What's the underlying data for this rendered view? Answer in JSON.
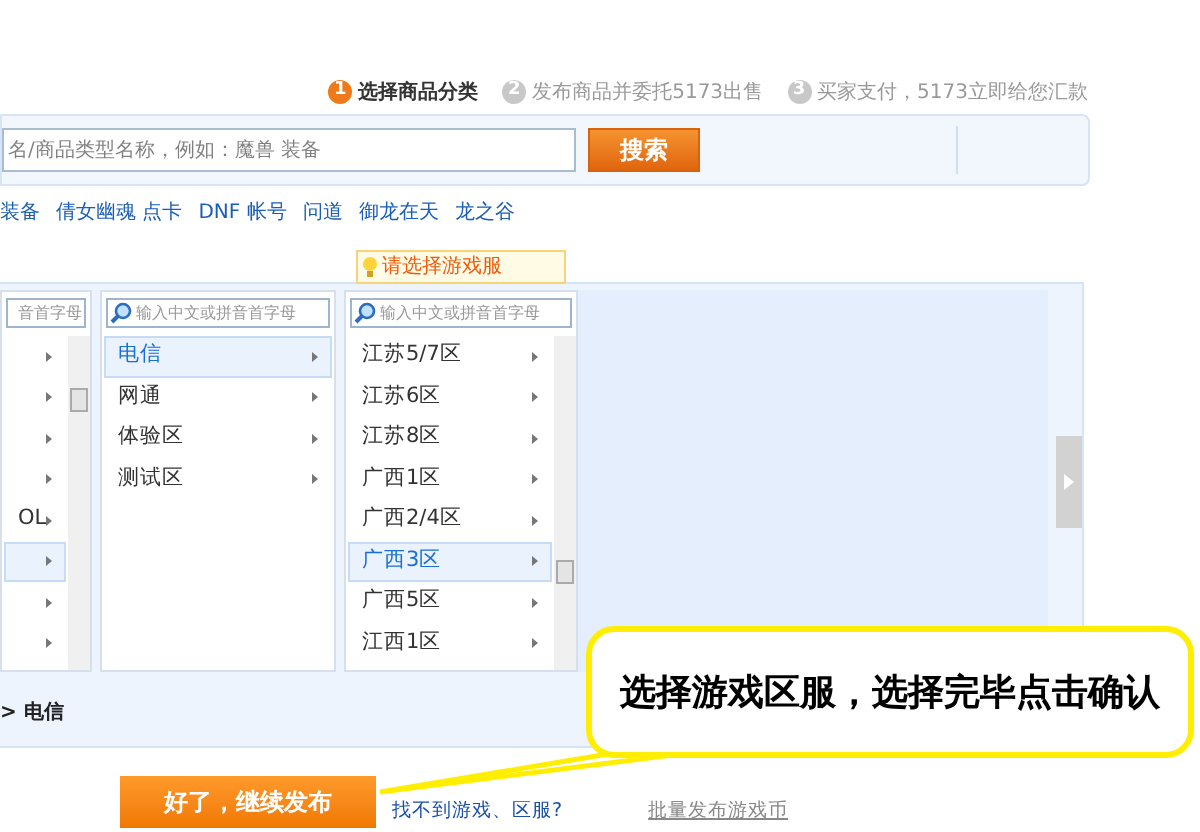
{
  "steps": [
    {
      "number": "1",
      "label": "选择商品分类",
      "selected": true
    },
    {
      "number": "2",
      "label": "发布商品并委托5173出售",
      "selected": false
    },
    {
      "number": "3",
      "label": "买家支付，5173立即给您汇款",
      "selected": false
    }
  ],
  "search": {
    "placeholder": "名/商品类型名称，例如：魔兽 装备",
    "button": "搜索"
  },
  "hot_links": [
    "装备",
    "倩女幽魂 点卡",
    "DNF 帐号",
    "问道",
    "御龙在天",
    "龙之谷"
  ],
  "tooltip": "请选择游戏服",
  "columns": [
    {
      "kind": "scrolling",
      "placeholder": "音首字母",
      "items": [
        {
          "selected": false
        },
        {
          "selected": false
        },
        {
          "selected": false
        },
        {
          "selected": false
        },
        {
          "label": "OL",
          "selected": false
        },
        {
          "selected": true
        },
        {
          "selected": false
        },
        {
          "selected": false
        }
      ]
    },
    {
      "kind": "plain",
      "placeholder": "输入中文或拼音首字母",
      "items": [
        {
          "label": "电信",
          "selected": true
        },
        {
          "label": "网通",
          "selected": false
        },
        {
          "label": "体验区",
          "selected": false
        },
        {
          "label": "测试区",
          "selected": false
        }
      ]
    },
    {
      "kind": "scrolling",
      "placeholder": "输入中文或拼音首字母",
      "items": [
        {
          "label": "江苏5/7区",
          "selected": false
        },
        {
          "label": "江苏6区",
          "selected": false
        },
        {
          "label": "江苏8区",
          "selected": false
        },
        {
          "label": "广西1区",
          "selected": false
        },
        {
          "label": "广西2/4区",
          "selected": false
        },
        {
          "label": "广西3区",
          "selected": true
        },
        {
          "label": "广西5区",
          "selected": false
        },
        {
          "label": "江西1区",
          "selected": false
        }
      ]
    }
  ],
  "breadcrumb": "> 电信",
  "callout": "选择游戏区服，选择完毕点击确认",
  "confirm_button": "好了，继续发布",
  "links": [
    {
      "kind": "help",
      "label": "找不到游戏、区服?"
    },
    {
      "kind": "muted",
      "label": "批量发布游戏币"
    }
  ]
}
